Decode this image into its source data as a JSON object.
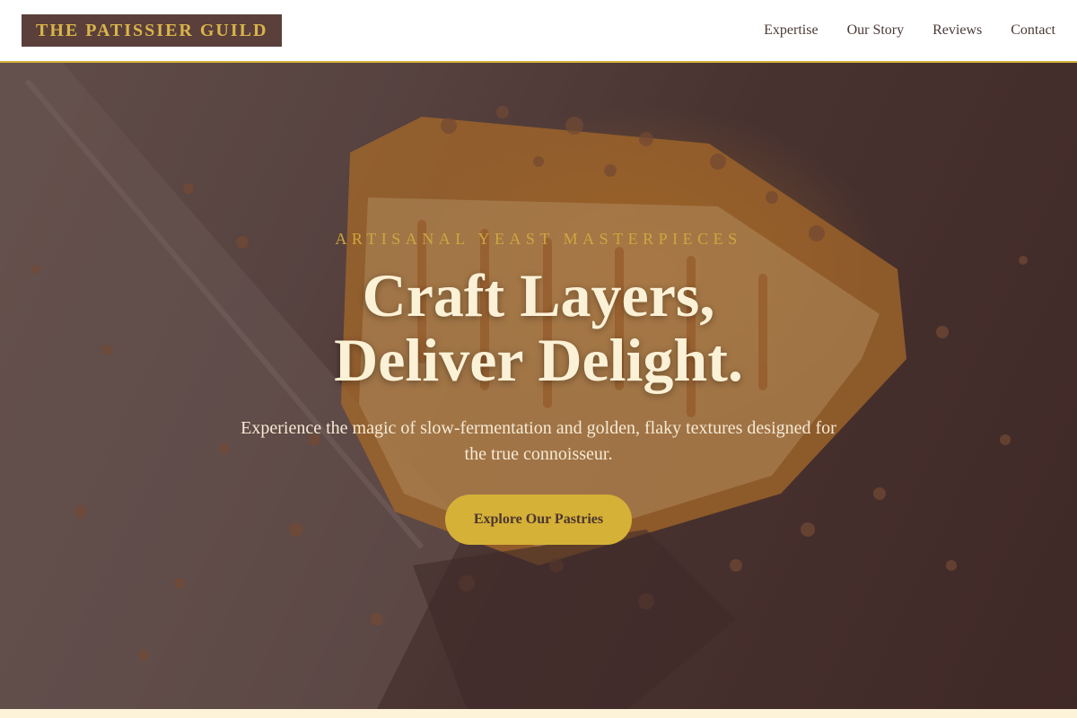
{
  "brand": {
    "name": "THE PATISSIER GUILD"
  },
  "nav": {
    "items": [
      {
        "label": "Expertise"
      },
      {
        "label": "Our Story"
      },
      {
        "label": "Reviews"
      },
      {
        "label": "Contact"
      }
    ]
  },
  "hero": {
    "eyebrow": "ARTISANAL YEAST MASTERPIECES",
    "headline_line1": "Craft Layers,",
    "headline_line2": "Deliver Delight.",
    "subtext": "Experience the magic of slow-fermentation and golden, flaky textures designed for the true connoisseur.",
    "cta_label": "Explore Our Pastries"
  },
  "colors": {
    "accent_gold": "#d6b137",
    "brand_brown": "#5a3f3a",
    "cream_text": "#fbf1d6"
  }
}
